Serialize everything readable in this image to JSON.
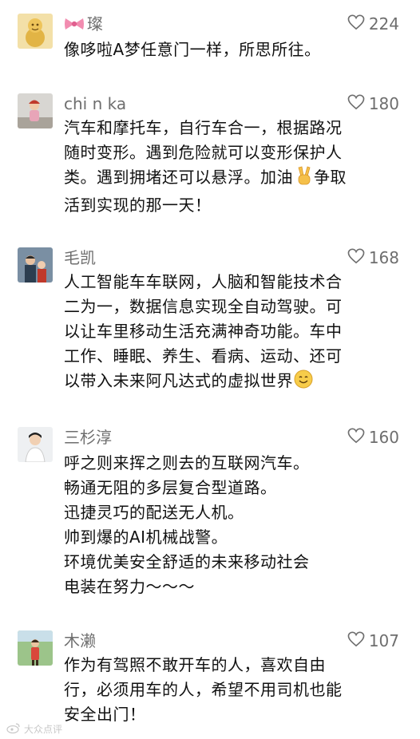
{
  "comments": [
    {
      "username": "璨",
      "likes": "224",
      "avatar_icon": "golden-figure-avatar-icon",
      "name_icon": "pink-bow-icon",
      "text": "像哆啦A梦任意门一样，所思所往。"
    },
    {
      "username": "chi n ka",
      "likes": "180",
      "avatar_icon": "child-photo-avatar-icon",
      "text_before": "汽车和摩托车，自行车合一，根据路况\n随时变形。遇到危险就可以变形保护人\n类。遇到拥堵还可以悬浮。加油",
      "emoji": "victory-hand-icon",
      "text_after": "争取\n活到实现的那一天！"
    },
    {
      "username": "毛凯",
      "likes": "168",
      "avatar_icon": "family-photo-avatar-icon",
      "text_before": "人工智能车车联网，人脑和智能技术合\n二为一，数据信息实现全自动驾驶。可\n以让车里移动生活充满神奇功能。车中\n工作、睡眠、养生、看病、运动、还可\n以带入未来阿凡达式的虚拟世界",
      "emoji": "smiling-face-icon"
    },
    {
      "username": "三杉淳",
      "likes": "160",
      "avatar_icon": "person-photo-avatar-icon",
      "text": "呼之则来挥之则去的互联网汽车。\n畅通无阻的多层复合型道路。\n迅捷灵巧的配送无人机。\n帅到爆的AI机械战警。\n环境优美安全舒适的未来移动社会\n电装在努力～～～"
    },
    {
      "username": "木濑",
      "likes": "107",
      "avatar_icon": "outdoor-photo-avatar-icon",
      "text": "作为有驾照不敢开车的人，喜欢自由\n行，必须用车的人，希望不用司机也能\n安全出门！"
    }
  ],
  "watermark": {
    "text": "大众点评",
    "icon": "weibo-logo-icon"
  },
  "colors": {
    "text": "#111111",
    "meta": "#6e6e6e",
    "watermark": "#c8c8c8"
  }
}
